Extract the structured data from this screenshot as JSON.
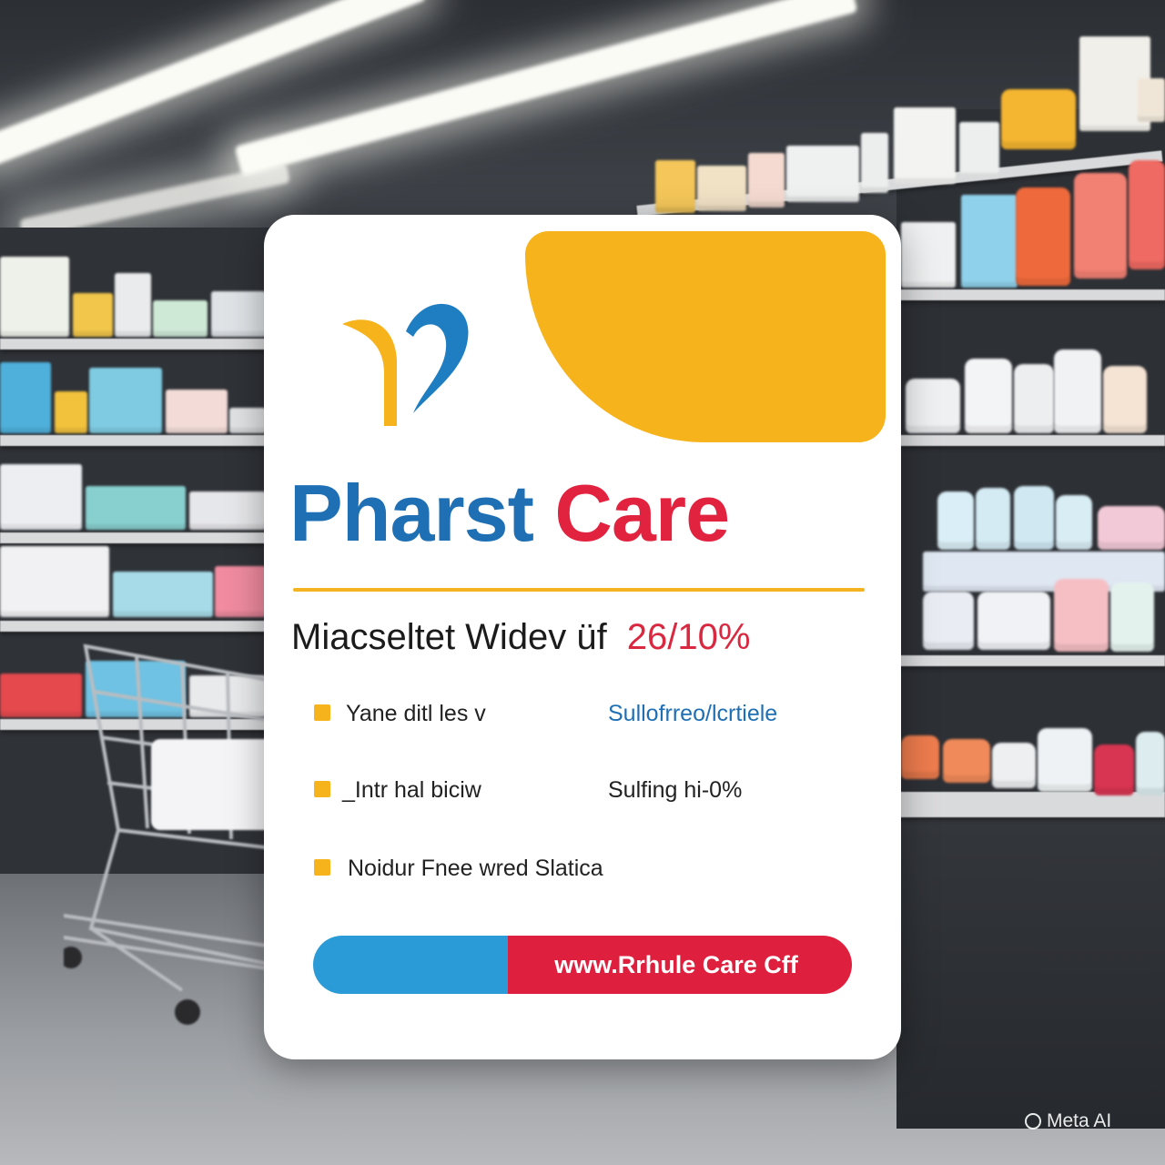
{
  "card": {
    "brand_left": "Pharst",
    "brand_right": "Care",
    "headline": "Miacseltet Widev üf",
    "headline_percent": "26/10%",
    "features": [
      {
        "left": "Yane ditl  les  v",
        "right": "Sullofrreo/lcrtiele"
      },
      {
        "left": "_Intr hal biciw",
        "right": "Sulfing hi-0%"
      },
      {
        "left": "Noidur Fnee wred Slatica",
        "right": ""
      }
    ],
    "url": "www.Rrhule Care Cff"
  },
  "watermark": {
    "text": "Meta AI"
  },
  "colors": {
    "brand_blue": "#1f6fb5",
    "brand_red": "#e1233f",
    "accent_yellow": "#f6b31b",
    "bar_blue": "#2a9bd6",
    "bar_red": "#de1f3d"
  }
}
